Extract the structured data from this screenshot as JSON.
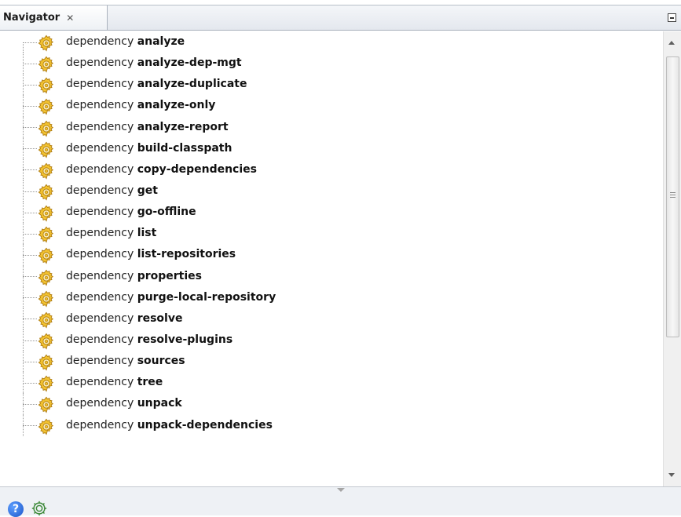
{
  "panel": {
    "title": "Navigator",
    "close_glyph": "✕",
    "minimize_icon": "minimize-icon"
  },
  "goals": [
    {
      "prefix": "dependency",
      "name": "analyze"
    },
    {
      "prefix": "dependency",
      "name": "analyze-dep-mgt"
    },
    {
      "prefix": "dependency",
      "name": "analyze-duplicate"
    },
    {
      "prefix": "dependency",
      "name": "analyze-only"
    },
    {
      "prefix": "dependency",
      "name": "analyze-report"
    },
    {
      "prefix": "dependency",
      "name": "build-classpath"
    },
    {
      "prefix": "dependency",
      "name": "copy-dependencies"
    },
    {
      "prefix": "dependency",
      "name": "get"
    },
    {
      "prefix": "dependency",
      "name": "go-offline"
    },
    {
      "prefix": "dependency",
      "name": "list"
    },
    {
      "prefix": "dependency",
      "name": "list-repositories"
    },
    {
      "prefix": "dependency",
      "name": "properties"
    },
    {
      "prefix": "dependency",
      "name": "purge-local-repository"
    },
    {
      "prefix": "dependency",
      "name": "resolve"
    },
    {
      "prefix": "dependency",
      "name": "resolve-plugins"
    },
    {
      "prefix": "dependency",
      "name": "sources"
    },
    {
      "prefix": "dependency",
      "name": "tree"
    },
    {
      "prefix": "dependency",
      "name": "unpack"
    },
    {
      "prefix": "dependency",
      "name": "unpack-dependencies"
    }
  ],
  "icons": {
    "goal": "gear-icon",
    "help": "help-icon",
    "footer_goal": "gear-icon"
  },
  "footer": {
    "help_glyph": "?"
  },
  "colors": {
    "gear_fill": "#f2c230",
    "gear_stroke": "#b07d12",
    "help_blue": "#1b55c9",
    "footer_gear": "#3e8a3a"
  }
}
